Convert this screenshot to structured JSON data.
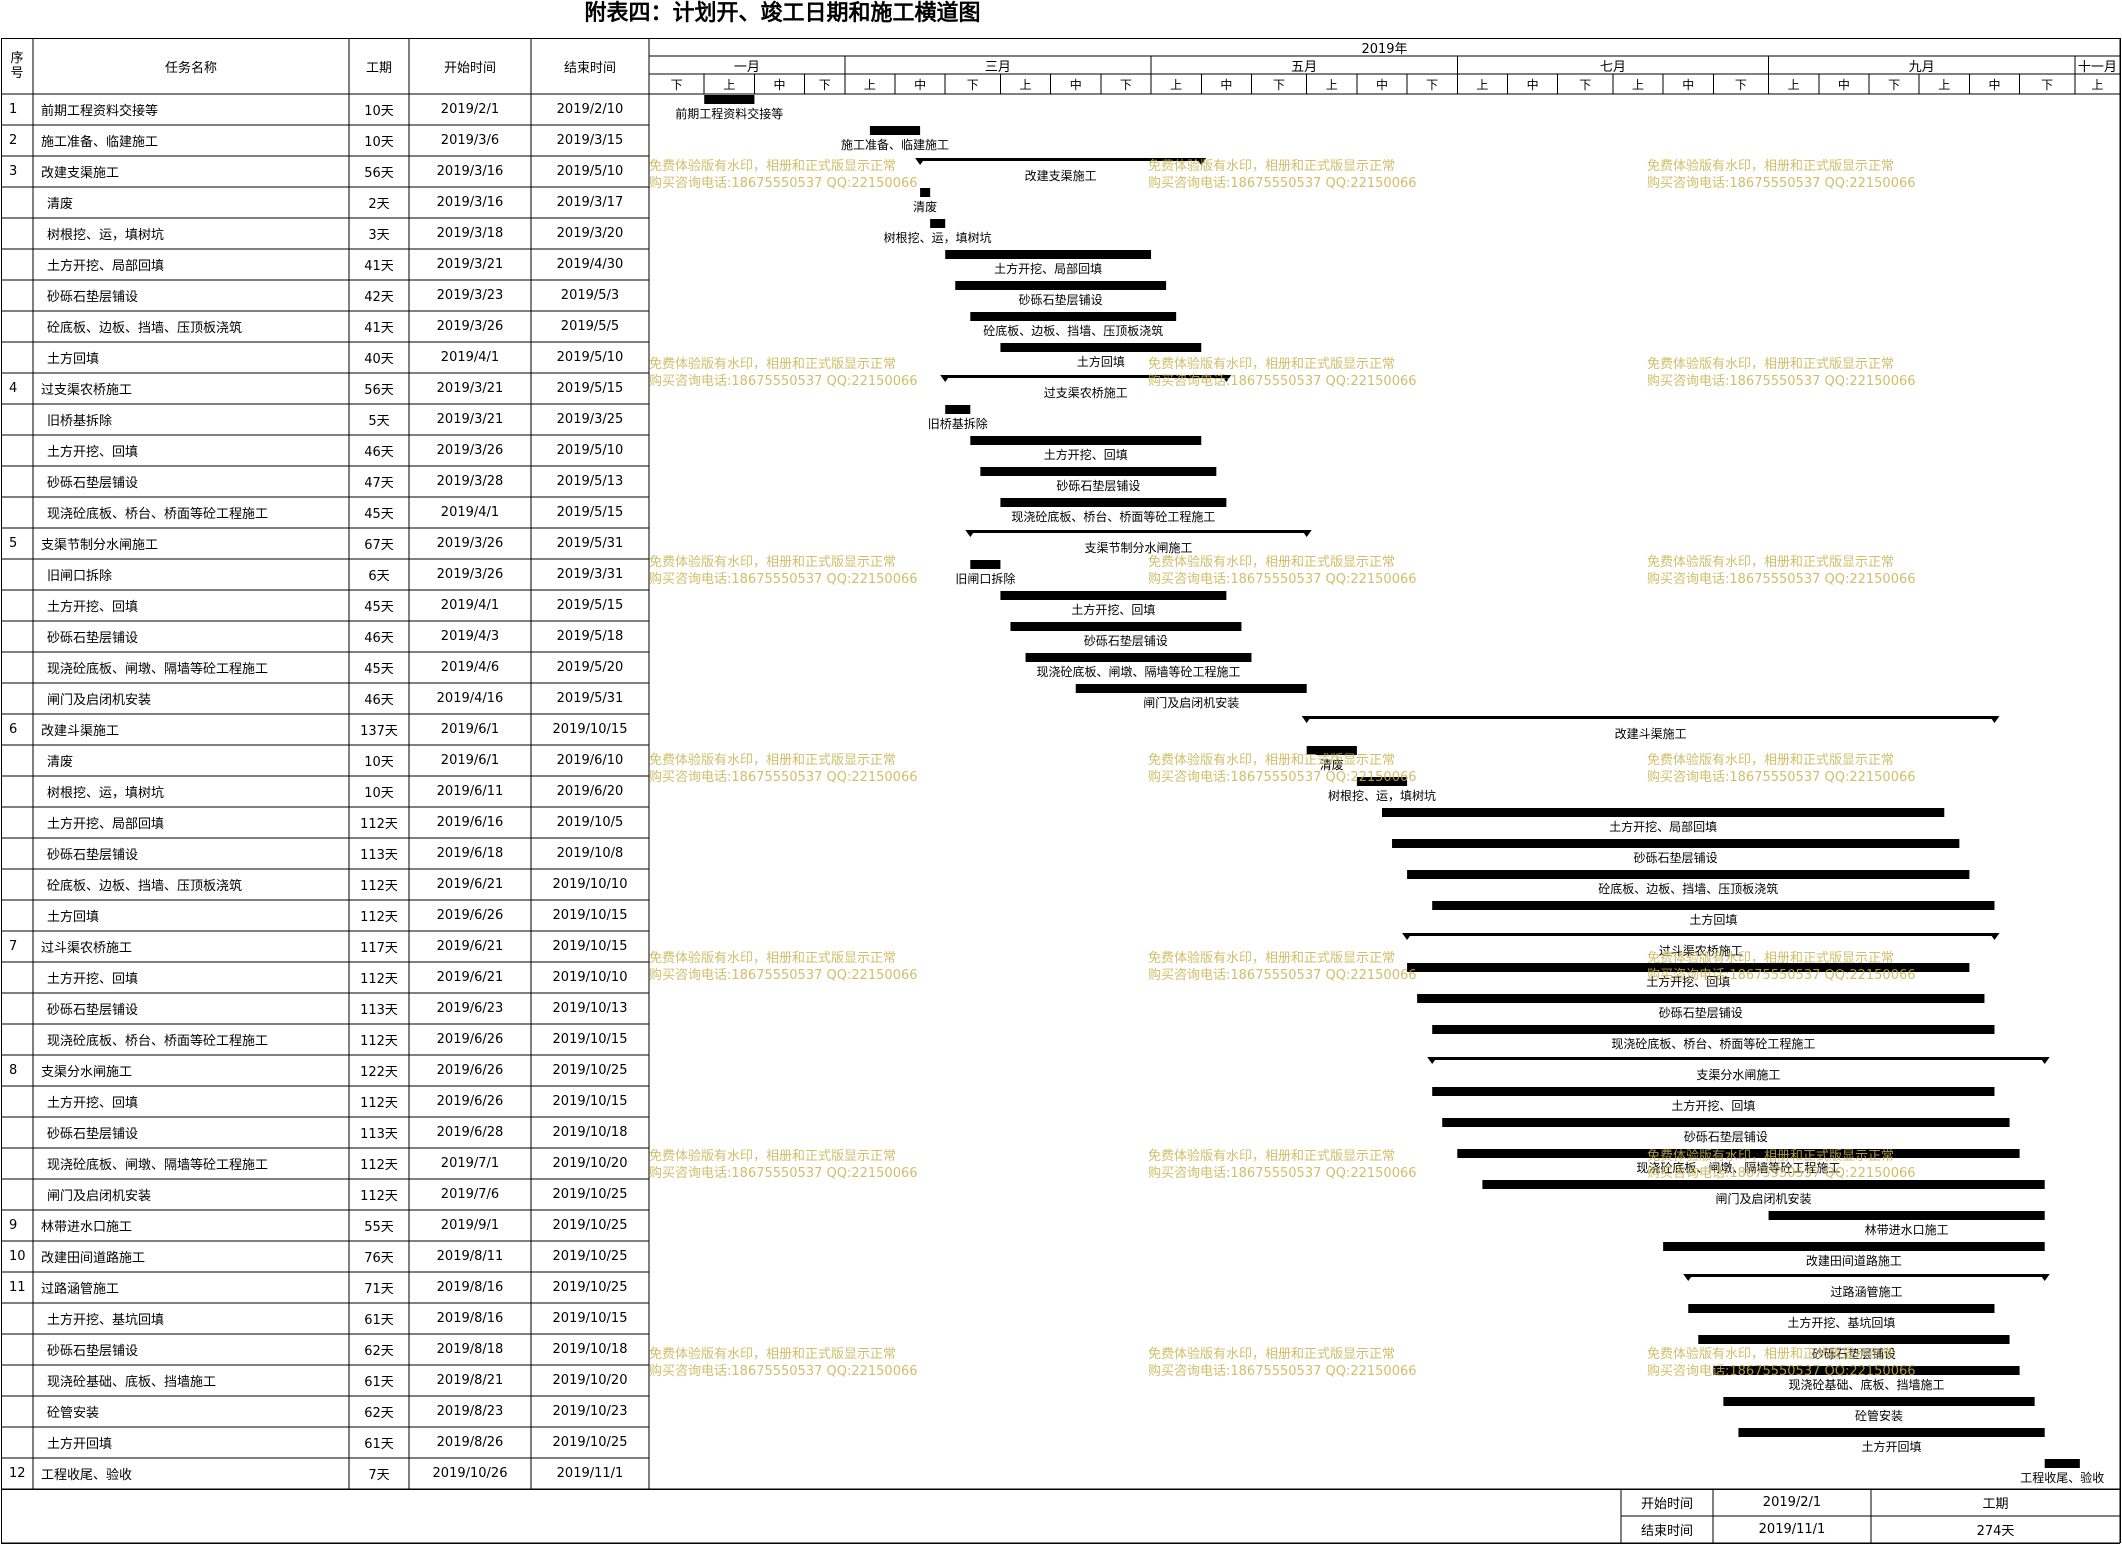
{
  "title": "附表四：计划开、竣工日期和施工横道图",
  "columns": {
    "no": "序号",
    "name": "任务名称",
    "duration": "工期",
    "start": "开始时间",
    "end": "结束时间"
  },
  "timeline": {
    "year": "2019年",
    "months": [
      "一月",
      "三月",
      "五月",
      "七月",
      "九月",
      "十一月"
    ],
    "periods": [
      "下",
      "上",
      "中",
      "下",
      "上",
      "中",
      "下",
      "上",
      "中",
      "下",
      "上",
      "中",
      "下",
      "上",
      "中",
      "下",
      "上",
      "中",
      "下",
      "上",
      "中",
      "下",
      "上",
      "中",
      "下",
      "上",
      "中",
      "下",
      "上"
    ]
  },
  "watermark": {
    "line1": "免费体验版有水印，相册和正式版显示正常",
    "line2": "购买咨询电话:18675550537 QQ:22150066"
  },
  "footer": {
    "start_label": "开始时间",
    "start_value": "2019/2/1",
    "end_label": "结束时间",
    "end_value": "2019/11/1",
    "duration_label": "工期",
    "duration_value": "274天"
  },
  "chart_data": {
    "type": "gantt",
    "title": "附表四：计划开、竣工日期和施工横道图",
    "x_axis": {
      "start": "2019-01-21",
      "end": "2019-11-10",
      "label": "2019年"
    },
    "tasks": [
      {
        "no": "1",
        "name": "前期工程资料交接等",
        "duration": "10天",
        "start": "2019/2/1",
        "end": "2019/2/10",
        "level": 0,
        "summary": false
      },
      {
        "no": "2",
        "name": "施工准备、临建施工",
        "duration": "10天",
        "start": "2019/3/6",
        "end": "2019/3/15",
        "level": 0,
        "summary": false
      },
      {
        "no": "3",
        "name": "改建支渠施工",
        "duration": "56天",
        "start": "2019/3/16",
        "end": "2019/5/10",
        "level": 0,
        "summary": true
      },
      {
        "no": "",
        "name": "清废",
        "duration": "2天",
        "start": "2019/3/16",
        "end": "2019/3/17",
        "level": 1,
        "summary": false
      },
      {
        "no": "",
        "name": "树根挖、运，填树坑",
        "duration": "3天",
        "start": "2019/3/18",
        "end": "2019/3/20",
        "level": 1,
        "summary": false
      },
      {
        "no": "",
        "name": "土方开挖、局部回填",
        "duration": "41天",
        "start": "2019/3/21",
        "end": "2019/4/30",
        "level": 1,
        "summary": false
      },
      {
        "no": "",
        "name": "砂砾石垫层铺设",
        "duration": "42天",
        "start": "2019/3/23",
        "end": "2019/5/3",
        "level": 1,
        "summary": false
      },
      {
        "no": "",
        "name": "砼底板、边板、挡墙、压顶板浇筑",
        "duration": "41天",
        "start": "2019/3/26",
        "end": "2019/5/5",
        "level": 1,
        "summary": false
      },
      {
        "no": "",
        "name": "土方回填",
        "duration": "40天",
        "start": "2019/4/1",
        "end": "2019/5/10",
        "level": 1,
        "summary": false
      },
      {
        "no": "4",
        "name": "过支渠农桥施工",
        "duration": "56天",
        "start": "2019/3/21",
        "end": "2019/5/15",
        "level": 0,
        "summary": true
      },
      {
        "no": "",
        "name": "旧桥基拆除",
        "duration": "5天",
        "start": "2019/3/21",
        "end": "2019/3/25",
        "level": 1,
        "summary": false
      },
      {
        "no": "",
        "name": "土方开挖、回填",
        "duration": "46天",
        "start": "2019/3/26",
        "end": "2019/5/10",
        "level": 1,
        "summary": false
      },
      {
        "no": "",
        "name": "砂砾石垫层铺设",
        "duration": "47天",
        "start": "2019/3/28",
        "end": "2019/5/13",
        "level": 1,
        "summary": false
      },
      {
        "no": "",
        "name": "现浇砼底板、桥台、桥面等砼工程施工",
        "duration": "45天",
        "start": "2019/4/1",
        "end": "2019/5/15",
        "level": 1,
        "summary": false
      },
      {
        "no": "5",
        "name": "支渠节制分水闸施工",
        "duration": "67天",
        "start": "2019/3/26",
        "end": "2019/5/31",
        "level": 0,
        "summary": true
      },
      {
        "no": "",
        "name": "旧闸口拆除",
        "duration": "6天",
        "start": "2019/3/26",
        "end": "2019/3/31",
        "level": 1,
        "summary": false
      },
      {
        "no": "",
        "name": "土方开挖、回填",
        "duration": "45天",
        "start": "2019/4/1",
        "end": "2019/5/15",
        "level": 1,
        "summary": false
      },
      {
        "no": "",
        "name": "砂砾石垫层铺设",
        "duration": "46天",
        "start": "2019/4/3",
        "end": "2019/5/18",
        "level": 1,
        "summary": false
      },
      {
        "no": "",
        "name": "现浇砼底板、闸墩、隔墙等砼工程施工",
        "duration": "45天",
        "start": "2019/4/6",
        "end": "2019/5/20",
        "level": 1,
        "summary": false
      },
      {
        "no": "",
        "name": "闸门及启闭机安装",
        "duration": "46天",
        "start": "2019/4/16",
        "end": "2019/5/31",
        "level": 1,
        "summary": false
      },
      {
        "no": "6",
        "name": "改建斗渠施工",
        "duration": "137天",
        "start": "2019/6/1",
        "end": "2019/10/15",
        "level": 0,
        "summary": true
      },
      {
        "no": "",
        "name": "清废",
        "duration": "10天",
        "start": "2019/6/1",
        "end": "2019/6/10",
        "level": 1,
        "summary": false
      },
      {
        "no": "",
        "name": "树根挖、运，填树坑",
        "duration": "10天",
        "start": "2019/6/11",
        "end": "2019/6/20",
        "level": 1,
        "summary": false
      },
      {
        "no": "",
        "name": "土方开挖、局部回填",
        "duration": "112天",
        "start": "2019/6/16",
        "end": "2019/10/5",
        "level": 1,
        "summary": false
      },
      {
        "no": "",
        "name": "砂砾石垫层铺设",
        "duration": "113天",
        "start": "2019/6/18",
        "end": "2019/10/8",
        "level": 1,
        "summary": false
      },
      {
        "no": "",
        "name": "砼底板、边板、挡墙、压顶板浇筑",
        "duration": "112天",
        "start": "2019/6/21",
        "end": "2019/10/10",
        "level": 1,
        "summary": false
      },
      {
        "no": "",
        "name": "土方回填",
        "duration": "112天",
        "start": "2019/6/26",
        "end": "2019/10/15",
        "level": 1,
        "summary": false
      },
      {
        "no": "7",
        "name": "过斗渠农桥施工",
        "duration": "117天",
        "start": "2019/6/21",
        "end": "2019/10/15",
        "level": 0,
        "summary": true
      },
      {
        "no": "",
        "name": "土方开挖、回填",
        "duration": "112天",
        "start": "2019/6/21",
        "end": "2019/10/10",
        "level": 1,
        "summary": false
      },
      {
        "no": "",
        "name": "砂砾石垫层铺设",
        "duration": "113天",
        "start": "2019/6/23",
        "end": "2019/10/13",
        "level": 1,
        "summary": false
      },
      {
        "no": "",
        "name": "现浇砼底板、桥台、桥面等砼工程施工",
        "duration": "112天",
        "start": "2019/6/26",
        "end": "2019/10/15",
        "level": 1,
        "summary": false
      },
      {
        "no": "8",
        "name": "支渠分水闸施工",
        "duration": "122天",
        "start": "2019/6/26",
        "end": "2019/10/25",
        "level": 0,
        "summary": true
      },
      {
        "no": "",
        "name": "土方开挖、回填",
        "duration": "112天",
        "start": "2019/6/26",
        "end": "2019/10/15",
        "level": 1,
        "summary": false
      },
      {
        "no": "",
        "name": "砂砾石垫层铺设",
        "duration": "113天",
        "start": "2019/6/28",
        "end": "2019/10/18",
        "level": 1,
        "summary": false
      },
      {
        "no": "",
        "name": "现浇砼底板、闸墩、隔墙等砼工程施工",
        "duration": "112天",
        "start": "2019/7/1",
        "end": "2019/10/20",
        "level": 1,
        "summary": false
      },
      {
        "no": "",
        "name": "闸门及启闭机安装",
        "duration": "112天",
        "start": "2019/7/6",
        "end": "2019/10/25",
        "level": 1,
        "summary": false
      },
      {
        "no": "9",
        "name": "林带进水口施工",
        "duration": "55天",
        "start": "2019/9/1",
        "end": "2019/10/25",
        "level": 0,
        "summary": false
      },
      {
        "no": "10",
        "name": "改建田间道路施工",
        "duration": "76天",
        "start": "2019/8/11",
        "end": "2019/10/25",
        "level": 0,
        "summary": false
      },
      {
        "no": "11",
        "name": "过路涵管施工",
        "duration": "71天",
        "start": "2019/8/16",
        "end": "2019/10/25",
        "level": 0,
        "summary": true
      },
      {
        "no": "",
        "name": "土方开挖、基坑回填",
        "duration": "61天",
        "start": "2019/8/16",
        "end": "2019/10/15",
        "level": 1,
        "summary": false
      },
      {
        "no": "",
        "name": "砂砾石垫层铺设",
        "duration": "62天",
        "start": "2019/8/18",
        "end": "2019/10/18",
        "level": 1,
        "summary": false
      },
      {
        "no": "",
        "name": "现浇砼基础、底板、挡墙施工",
        "duration": "61天",
        "start": "2019/8/21",
        "end": "2019/10/20",
        "level": 1,
        "summary": false
      },
      {
        "no": "",
        "name": "砼管安装",
        "duration": "62天",
        "start": "2019/8/23",
        "end": "2019/10/23",
        "level": 1,
        "summary": false
      },
      {
        "no": "",
        "name": "土方开回填",
        "duration": "61天",
        "start": "2019/8/26",
        "end": "2019/10/25",
        "level": 1,
        "summary": false
      },
      {
        "no": "12",
        "name": "工程收尾、验收",
        "duration": "7天",
        "start": "2019/10/26",
        "end": "2019/11/1",
        "level": 0,
        "summary": false
      }
    ]
  }
}
